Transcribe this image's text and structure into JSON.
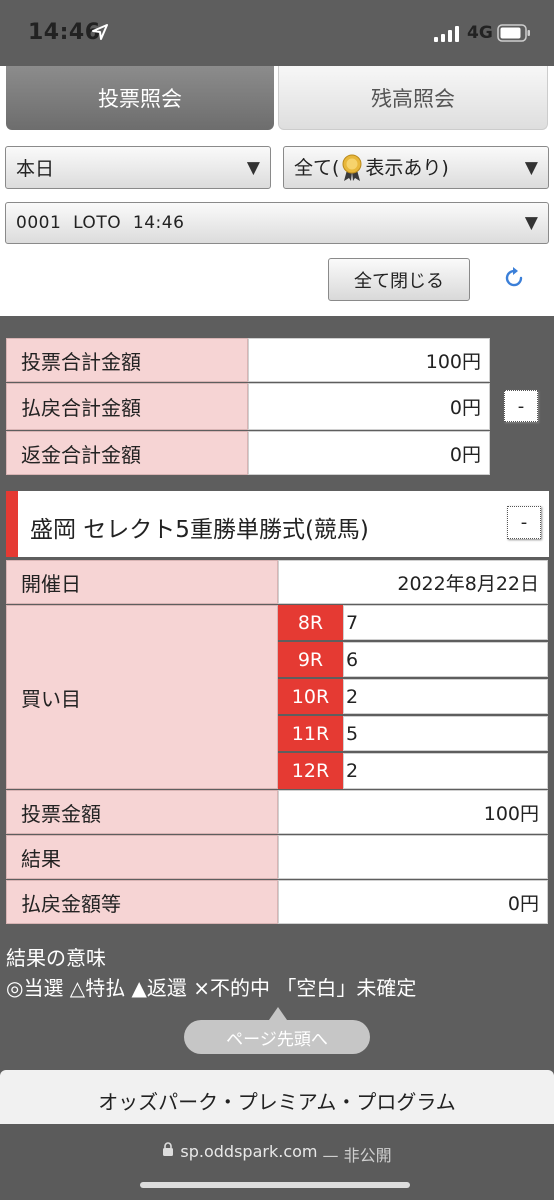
{
  "status": {
    "time": "14:46",
    "network": "4G"
  },
  "tabs": {
    "vote": "投票照会",
    "balance": "残高照会"
  },
  "filters": {
    "day": "本日",
    "filter_prefix": "全て(",
    "filter_suffix": "表示あり)",
    "ticket": "0001  LOTO  14:46"
  },
  "close_all_label": "全て閉じる",
  "summary": {
    "rows": [
      {
        "label": "投票合計金額",
        "value": "100円"
      },
      {
        "label": "払戻合計金額",
        "value": "0円"
      },
      {
        "label": "返金合計金額",
        "value": "0円"
      }
    ],
    "toggle_label": "-"
  },
  "race": {
    "title": "盛岡 セレクト5重勝単勝式(競馬)",
    "toggle_label": "-",
    "date_label": "開催日",
    "date_value": "2022年8月22日",
    "picks_label": "買い目",
    "picks": [
      {
        "race": "8R",
        "pick": "7"
      },
      {
        "race": "9R",
        "pick": "6"
      },
      {
        "race": "10R",
        "pick": "2"
      },
      {
        "race": "11R",
        "pick": "5"
      },
      {
        "race": "12R",
        "pick": "2"
      }
    ],
    "amount_label": "投票金額",
    "amount_value": "100円",
    "result_label": "結果",
    "result_value": "",
    "payout_label": "払戻金額等",
    "payout_value": "0円"
  },
  "legend": {
    "title": "結果の意味",
    "text": "◎当選 △特払 ▲返還 ×不的中 「空白」未確定"
  },
  "page_top_label": "ページ先頭へ",
  "footer_label": "オッズパーク・プレミアム・プログラム",
  "url": {
    "domain": "sp.oddspark.com",
    "privacy": "— 非公開"
  },
  "colors": {
    "accent_red": "#e53a33",
    "label_pink": "#f6d4d4",
    "background": "#5e5e5e"
  }
}
